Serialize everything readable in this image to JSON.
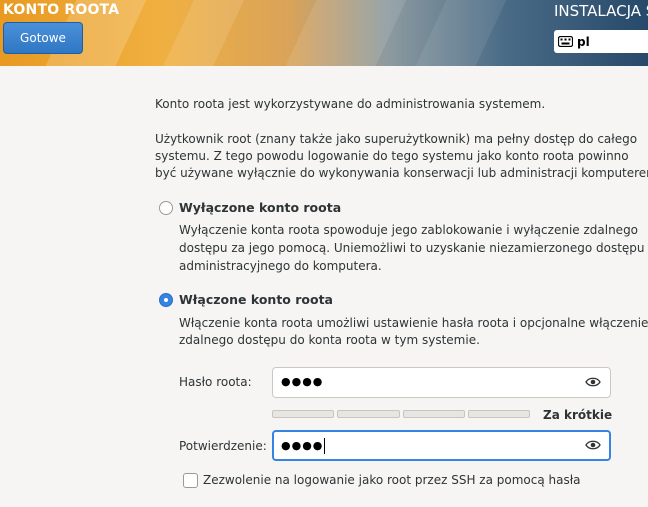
{
  "header": {
    "title": "KONTO ROOTA",
    "done_label": "Gotowe",
    "install_title": "INSTALACJA S",
    "keyboard_layout": "pl",
    "keyboard_icon": "keyboard-icon"
  },
  "content": {
    "intro": "Konto roota jest wykorzystywane do administrowania systemem.",
    "desc_line1": "Użytkownik root (znany także jako superużytkownik) ma pełny dostęp do całego",
    "desc_line2": "systemu. Z tego powodu logowanie do tego systemu jako konto roota powinno",
    "desc_line3": "być używane wyłącznie do wykonywania konserwacji lub administracji komputerem.",
    "disable": {
      "label": "Wyłączone konto roota",
      "line1": "Wyłączenie konta roota spowoduje jego zablokowanie i wyłączenie zdalnego",
      "line2": "dostępu za jego pomocą. Uniemożliwi to uzyskanie niezamierzonego dostępu",
      "line3": "administracyjnego do komputera.",
      "selected": false
    },
    "enable": {
      "label": "Włączone konto roota",
      "line1": "Włączenie konta roota umożliwi ustawienie hasła roota i opcjonalne włączenie",
      "line2": "zdalnego dostępu do konta roota w tym systemie.",
      "selected": true
    },
    "password": {
      "label": "Hasło roota:",
      "value": "●●●●",
      "eye_icon": "eye-icon"
    },
    "strength": {
      "label": "Za krótkie",
      "level": 0
    },
    "confirm": {
      "label": "Potwierdzenie:",
      "value": "●●●●",
      "eye_icon": "eye-icon"
    },
    "ssh": {
      "label": "Zezwolenie na logowanie jako root przez SSH za pomocą hasła",
      "checked": false
    }
  },
  "colors": {
    "accent": "#3584e4",
    "header_orange": "#e89a22",
    "header_blue": "#27496a"
  }
}
